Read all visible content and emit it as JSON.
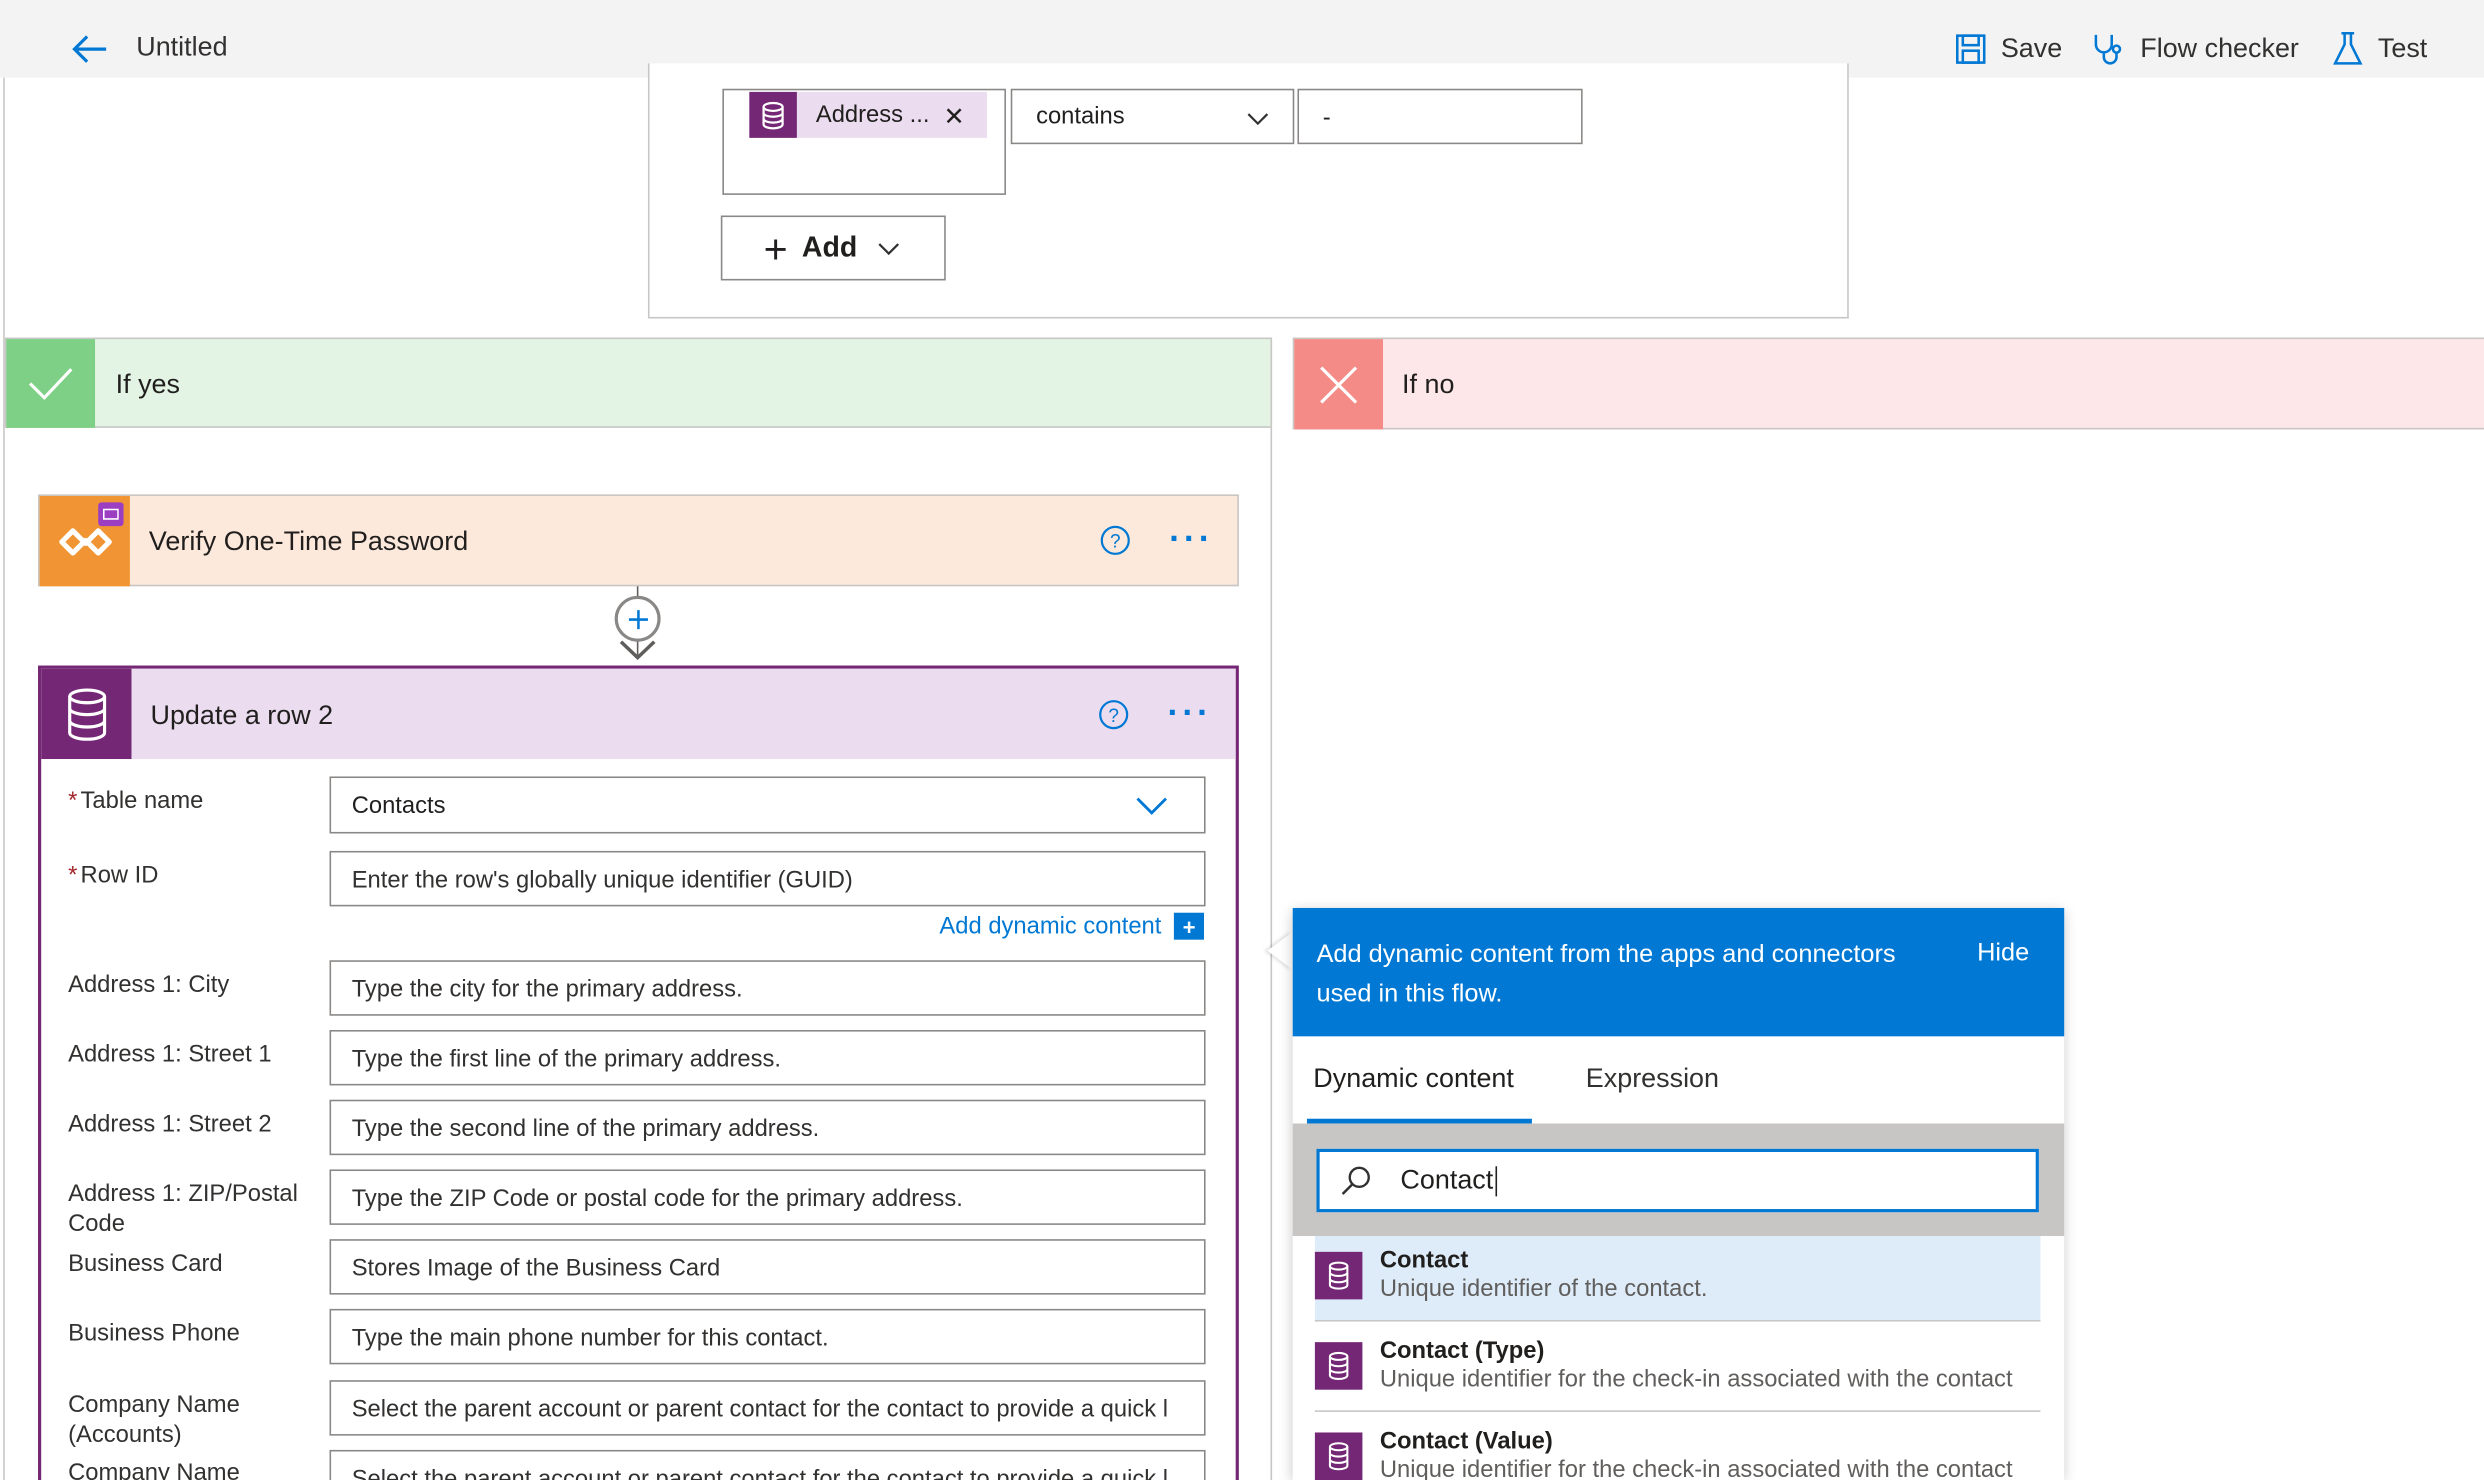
{
  "topbar": {
    "title": "Untitled",
    "save_label": "Save",
    "flow_checker_label": "Flow checker",
    "test_label": "Test"
  },
  "condition": {
    "token_label": "Address ...",
    "operator": "contains",
    "value": "-",
    "add_label": "Add"
  },
  "branches": {
    "yes_label": "If yes",
    "no_label": "If no"
  },
  "verify_card": {
    "title": "Verify One-Time Password"
  },
  "update_card": {
    "title": "Update a row 2",
    "fields": [
      {
        "label": "Table name",
        "value": "Contacts"
      },
      {
        "label": "Row ID",
        "placeholder": "Enter the row's globally unique identifier (GUID)"
      },
      {
        "label": "Address 1: City",
        "placeholder": "Type the city for the primary address."
      },
      {
        "label": "Address 1: Street 1",
        "placeholder": "Type the first line of the primary address."
      },
      {
        "label": "Address 1: Street 2",
        "placeholder": "Type the second line of the primary address."
      },
      {
        "label": "Address 1: ZIP/Postal Code",
        "placeholder": "Type the ZIP Code or postal code for the primary address."
      },
      {
        "label": "Business Card",
        "placeholder": "Stores Image of the Business Card"
      },
      {
        "label": "Business Phone",
        "placeholder": "Type the main phone number for this contact."
      },
      {
        "label": "Company Name (Accounts)",
        "placeholder": "Select the parent account or parent contact for the contact to provide a quick l"
      },
      {
        "label": "Company Name",
        "placeholder": "Select the parent account or parent contact for the contact to provide a quick l"
      }
    ],
    "add_dynamic_label": "Add dynamic content"
  },
  "dynamic_panel": {
    "header_text": "Add dynamic content from the apps and connectors used in this flow.",
    "hide_label": "Hide",
    "tabs": [
      "Dynamic content",
      "Expression"
    ],
    "search_value": "Contact",
    "items": [
      {
        "name": "Contact",
        "desc": "Unique identifier of the contact."
      },
      {
        "name": "Contact (Type)",
        "desc": "Unique identifier for the check-in associated with the contact"
      },
      {
        "name": "Contact (Value)",
        "desc": "Unique identifier for the check-in associated with the contact"
      }
    ]
  },
  "colors": {
    "accent": "#0078d4",
    "dataverse": "#742774",
    "yes_green": "#7dd085",
    "no_red": "#f48b86",
    "otp_orange": "#f19433"
  }
}
